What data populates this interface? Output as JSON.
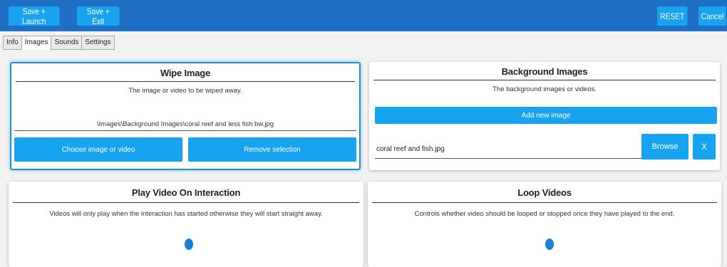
{
  "toolbar": {
    "save_launch": "Save + Launch",
    "save_exit": "Save + Exit",
    "reset": "RESET",
    "cancel": "Cancel"
  },
  "tabs": [
    {
      "label": "Info",
      "active": false
    },
    {
      "label": "Images",
      "active": true
    },
    {
      "label": "Sounds",
      "active": false
    },
    {
      "label": "Settings",
      "active": false
    }
  ],
  "wipe_image": {
    "title": "Wipe Image",
    "description": "The image or video to be wiped away.",
    "path": "\\Images\\Background Images\\coral reef and less fish bw.jpg",
    "choose_label": "Choose image or video",
    "remove_label": "Remove selection"
  },
  "background_images": {
    "title": "Background Images",
    "description": "The background images or videos.",
    "add_label": "Add new image",
    "items": [
      {
        "filename": "coral reef and fish.jpg",
        "browse_label": "Browse",
        "remove_label": "X"
      }
    ]
  },
  "play_video": {
    "title": "Play Video On Interaction",
    "description": "Videos will only play when the interaction has started otherwise they will start straight away."
  },
  "loop_videos": {
    "title": "Loop Videos",
    "description": "Controls whether video should be looped or stopped once they have played to the end."
  },
  "colors": {
    "topbar": "#1f6fc4",
    "button": "#18a3f0",
    "selection_border": "#1a8fd6",
    "toggle": "#1a7fd6"
  }
}
